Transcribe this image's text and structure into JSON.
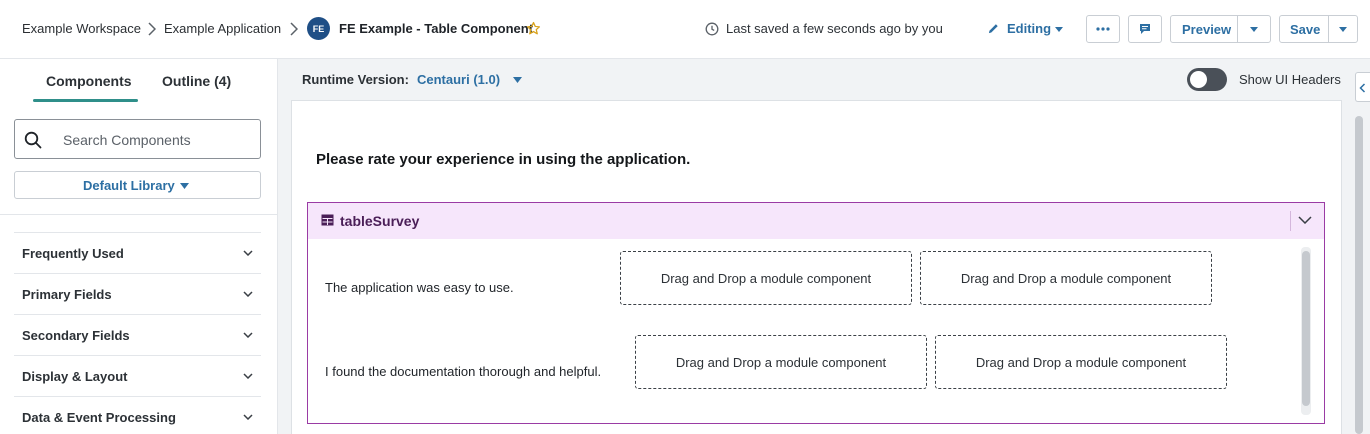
{
  "header": {
    "breadcrumbs": [
      "Example Workspace",
      "Example Application"
    ],
    "app_badge": "FE",
    "app_title": "FE Example - Table Component",
    "saved_status": "Last saved a few seconds ago by you",
    "mode_label": "Editing",
    "preview_label": "Preview",
    "save_label": "Save"
  },
  "sidebar": {
    "tabs": [
      "Components",
      "Outline (4)"
    ],
    "active_tab": "Components",
    "search_placeholder": "Search Components",
    "library_label": "Default Library",
    "categories": [
      "Frequently Used",
      "Primary Fields",
      "Secondary Fields",
      "Display & Layout",
      "Data & Event Processing"
    ]
  },
  "main": {
    "runtime_label": "Runtime Version:",
    "runtime_value": "Centauri (1.0)",
    "toggle_label": "Show UI Headers",
    "toggle_on": false,
    "question": "Please rate your experience in using the application.",
    "component": {
      "name": "tableSurvey",
      "rows": [
        {
          "label": "The application was easy to use.",
          "cells": [
            "Drag and Drop a module component",
            "Drag and Drop a module component"
          ]
        },
        {
          "label": "I found the documentation thorough and helpful.",
          "cells": [
            "Drag and Drop a module component",
            "Drag and Drop a module component"
          ]
        }
      ]
    }
  },
  "colors": {
    "accent": "#2d6fa3",
    "tab_underline": "#2f8f8a",
    "component_border": "#9a3ba4",
    "component_header": "#f6e6fb",
    "badge": "#1f4f86",
    "star": "#d9a21b"
  }
}
